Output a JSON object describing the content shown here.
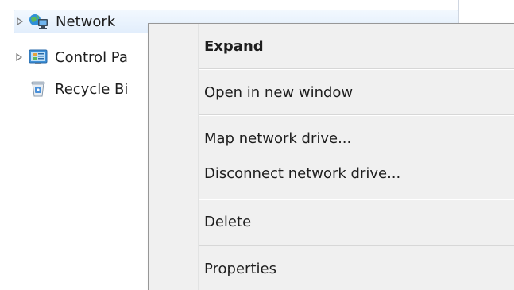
{
  "tree": {
    "items": [
      {
        "label": "Network",
        "icon": "network-icon",
        "expander": "collapsed"
      },
      {
        "label": "Control Pa",
        "icon": "control-panel-icon",
        "expander": "collapsed"
      },
      {
        "label": "Recycle Bi",
        "icon": "recycle-bin-icon",
        "expander": "none"
      }
    ]
  },
  "context_menu": {
    "items": [
      {
        "label": "Expand",
        "bold": true
      },
      {
        "label": "Open in new window"
      },
      {
        "label": "Map network drive..."
      },
      {
        "label": "Disconnect network drive..."
      },
      {
        "label": "Delete"
      },
      {
        "label": "Properties"
      }
    ]
  },
  "colors": {
    "menu_background": "#f0f0f0",
    "selection_background": "#e2eefc",
    "text": "#1e1e1e"
  }
}
